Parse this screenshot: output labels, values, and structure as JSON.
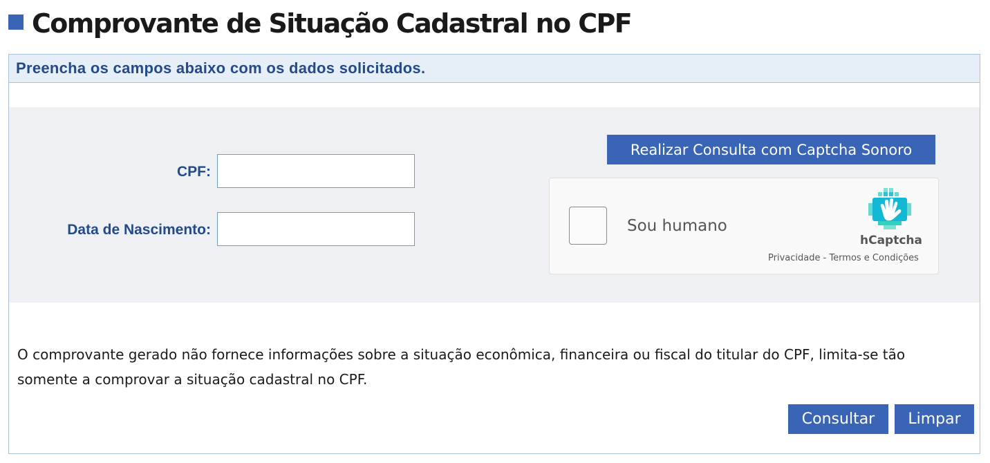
{
  "page": {
    "title": "Comprovante de Situação Cadastral no CPF"
  },
  "panel": {
    "heading": "Preencha os campos abaixo com os dados solicitados."
  },
  "form": {
    "cpf_label": "CPF:",
    "cpf_value": "",
    "birth_label": "Data de Nascimento:",
    "birth_value": ""
  },
  "audio_captcha_button": "Realizar Consulta com Captcha Sonoro",
  "captcha": {
    "checkbox_label": "Sou humano",
    "brand": "hCaptcha",
    "privacy_link": "Privacidade",
    "separator": " - ",
    "terms_link": "Termos e Condições",
    "logo_icon": "hcaptcha-hand-icon"
  },
  "disclaimer": "O comprovante gerado não fornece informações sobre a situação econômica, financeira ou fiscal do titular do CPF, limita-se tão somente a comprovar a situação cadastral no CPF.",
  "actions": {
    "submit_label": "Consultar",
    "clear_label": "Limpar"
  },
  "colors": {
    "primary": "#3a64b5",
    "heading_text": "#234a8a",
    "heading_bg": "#e6eef7",
    "form_bg": "#eff0f4",
    "border": "#a9c2d6"
  }
}
